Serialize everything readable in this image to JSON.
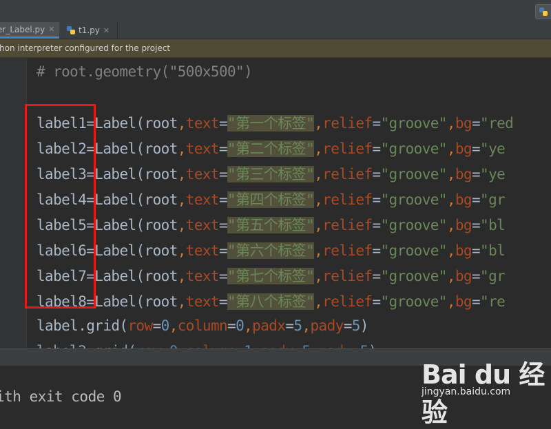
{
  "tabs": [
    {
      "label": "er_Label.py",
      "active": true
    },
    {
      "label": "t1.py",
      "active": false
    }
  ],
  "warning_banner": "hon interpreter configured for the project",
  "code_lines": {
    "comment": "# root.geometry(\"500x500\")",
    "l1": {
      "var": "label1",
      "text": "\"第一个标签\"",
      "bg": "\"red"
    },
    "l2": {
      "var": "label2",
      "text": "\"第二个标签\"",
      "bg": "\"ye"
    },
    "l3": {
      "var": "label3",
      "text": "\"第三个标签\"",
      "bg": "\"ye"
    },
    "l4": {
      "var": "label4",
      "text": "\"第四个标签\"",
      "bg": "\"gr"
    },
    "l5": {
      "var": "label5",
      "text": "\"第五个标签\"",
      "bg": "\"bl"
    },
    "l6": {
      "var": "label6",
      "text": "\"第六个标签\"",
      "bg": "\"bl"
    },
    "l7": {
      "var": "label7",
      "text": "\"第七个标签\"",
      "bg": "\"gr"
    },
    "l8": {
      "var": "label8",
      "text": "\"第八个标签\"",
      "bg": "\"re"
    },
    "grid_line": "label.grid(row=0,column=0,padx=5,pady=5)"
  },
  "console_output": "ith exit code 0",
  "watermark": {
    "logo": "Bai du 经验",
    "url": "jingyan.baidu.com"
  },
  "colors": {
    "highlight_box": "#e21b1b",
    "keyword": "#cc7832",
    "string": "#6a8759",
    "param": "#aa4926",
    "number": "#6897bb"
  }
}
